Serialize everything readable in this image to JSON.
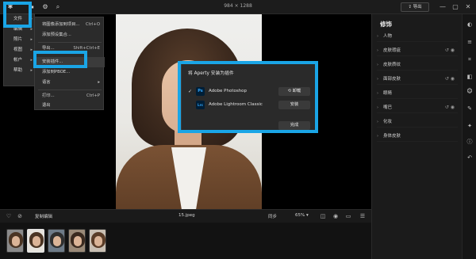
{
  "titlebar": {
    "dimensions": "984 × 1288",
    "export_label": "导出",
    "window_controls": [
      "—",
      "▢",
      "✕"
    ]
  },
  "menu_bar": {
    "items": [
      "文件",
      "编辑",
      "照片",
      "视图",
      "帐户",
      "帮助"
    ]
  },
  "file_menu": {
    "items": [
      {
        "label": "文件",
        "has_sub": true
      },
      {
        "label": "编辑",
        "has_sub": true
      },
      {
        "label": "照片",
        "has_sub": true
      },
      {
        "label": "视图",
        "has_sub": true
      },
      {
        "label": "帐户",
        "has_sub": true
      },
      {
        "label": "帮助",
        "has_sub": true
      }
    ]
  },
  "sub_menu": {
    "items": [
      {
        "label": "将图像添加到项目...",
        "shortcut": "Ctrl+O"
      },
      {
        "label": "添加预设集合...",
        "shortcut": ""
      },
      {
        "label": "导出...",
        "shortcut": "Shift+Ctrl+E"
      },
      {
        "label": "安装插件...",
        "shortcut": "",
        "highlighted": true
      },
      {
        "label": "添加到PBOE...",
        "shortcut": ""
      },
      {
        "label": "语言",
        "shortcut": "▸"
      },
      {
        "label": "打印...",
        "shortcut": "Ctrl+P"
      },
      {
        "label": "退出",
        "shortcut": ""
      }
    ]
  },
  "dialog": {
    "title": "将 Aperty 安装为插件",
    "rows": [
      {
        "checked": true,
        "icon": "Ps",
        "icon_color": "#31a8ff",
        "icon_bg": "#001e36",
        "name": "Adobe Photoshop",
        "button": "卸载"
      },
      {
        "checked": false,
        "icon": "Lrc",
        "icon_color": "#31a8ff",
        "icon_bg": "#001e36",
        "name": "Adobe Lightroom Classic",
        "button": "安装"
      }
    ],
    "done_label": "完成"
  },
  "right_panel": {
    "title": "修饰",
    "sections": [
      {
        "label": "人物",
        "tools": ""
      },
      {
        "label": "皮肤瑕疵",
        "tools": "↺ ◉"
      },
      {
        "label": "皮肤质纹",
        "tools": ""
      },
      {
        "label": "面部皮肤",
        "tools": "↺ ◉"
      },
      {
        "label": "眼睛",
        "tools": ""
      },
      {
        "label": "嘴巴",
        "tools": "↺ ◉"
      },
      {
        "label": "化妆",
        "tools": ""
      },
      {
        "label": "身体皮肤",
        "tools": ""
      }
    ]
  },
  "status_bar": {
    "left_label": "复制编辑",
    "filename": "15.jpeg",
    "compare_label": "同步",
    "zoom": "65%"
  },
  "filmstrip": {
    "thumbnail_count": 5,
    "selected_index": 1
  },
  "colors": {
    "highlight": "#1aa5e6",
    "panel_bg": "#1b1b1b",
    "canvas_bg": "#000000"
  }
}
